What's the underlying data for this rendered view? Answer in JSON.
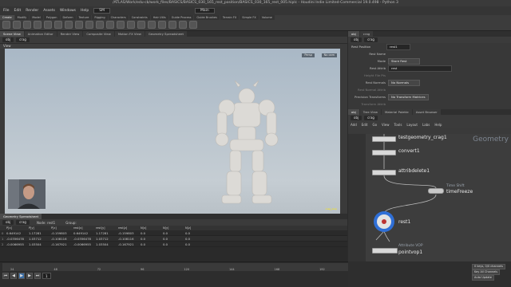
{
  "titlebar": {
    "text": "/ATLAS/Work/edu-cb/work_files/BASICS/BASICS_030_165_rest_position/BASICS_030_165_rest_005.hiplc - Houdini Indie Limited-Commercial 19.0.498 - Python 3"
  },
  "menus": [
    "File",
    "Edit",
    "Render",
    "Assets",
    "Windows",
    "Help"
  ],
  "desktop": "SM",
  "main_shelf": "Main",
  "shelf_tabs": [
    "Create",
    "Modify",
    "Model",
    "Polygon",
    "Deform",
    "Texture",
    "Rigging",
    "Characters",
    "Constraints",
    "Hair Utils",
    "Guide Process",
    "Guide Brushes",
    "Terrain FX",
    "Simple FX",
    "Volume"
  ],
  "shelf_tabs2": [
    "Lights and Cameras",
    "Collisions",
    "Particles",
    "Grains",
    "Vellum",
    "Rigid Bodies",
    "Particle Fluids",
    "Viscous Fluids",
    "Oceans",
    "Pyro FX",
    "FEM",
    "Wires",
    "Crowds",
    "Drive Simulation"
  ],
  "left_pane_tabs": [
    "Scene View",
    "Animation Editor",
    "Render View",
    "Composite View",
    "Motion FX View",
    "Geometry Spreadsheet"
  ],
  "left_path": {
    "obj": "obj",
    "node": "crag"
  },
  "viewport": {
    "label": "View",
    "persp": "Persp",
    "cam": "No cam",
    "corner_tag": "crag_loop"
  },
  "spreadsheet": {
    "tab": "Geometry Spreadsheet",
    "path_obj": "obj",
    "path_node": "crag",
    "node_label": "Node: rest1",
    "group_label": "Group:",
    "columns": [
      "",
      "P[x]",
      "P[y]",
      "P[z]",
      "rest[x]",
      "rest[y]",
      "rest[z]",
      "N[x]",
      "N[y]",
      "N[z]"
    ],
    "rows": [
      [
        "0",
        "0.649142",
        "1.17281",
        "-0.159803",
        "0.649142",
        "1.17281",
        "-0.159803",
        "0.0",
        "0.0",
        "0.0"
      ],
      [
        "1",
        "-0.0356478",
        "1.03712",
        "-0.108116",
        "-0.0356478",
        "1.03712",
        "-0.108116",
        "0.0",
        "0.0",
        "0.0"
      ],
      [
        "2",
        "-0.0066955",
        "1.03504",
        "-0.167921",
        "-0.0066955",
        "1.03504",
        "-0.167921",
        "0.0",
        "0.0",
        "0.0"
      ]
    ]
  },
  "timeline": {
    "ticks": [
      "24",
      "48",
      "72",
      "96",
      "120",
      "144",
      "168",
      "192",
      "216",
      "240"
    ],
    "current_frame": "1",
    "start": "1",
    "end": "240",
    "fps_label": "0 keys, 0/0 channels",
    "key_all": "Key All Channels",
    "auto_update": "Auto Update"
  },
  "right_top_tabs": [
    "obj",
    "crag",
    "Tree View",
    "Material Palette",
    "Asset Browser"
  ],
  "params": {
    "node_type": "Rest Position",
    "node_name": "rest1",
    "group_label": "Rest Name",
    "mode_label": "Mode",
    "mode_value": "Store Rest",
    "attrib_label": "Rest Attrib",
    "attrib_value": "rest",
    "height_label": "Height File Pts",
    "normals_label": "Rest Normals",
    "normals_value": "No Normals",
    "normal_attrib_label": "Rest Normal Attrib",
    "prec_label": "Precision Transforms",
    "prec_value": "No Transform Matrices",
    "transform_label": "Transform Attrib"
  },
  "network": {
    "tabs": [
      "obj",
      "crag"
    ],
    "menu": [
      "Add",
      "Edit",
      "Go",
      "View",
      "Tools",
      "Layout",
      "Labs",
      "Help"
    ],
    "watermark": "Geometry",
    "nodes": [
      {
        "name": "testgeometry_crag1"
      },
      {
        "name": "convert1"
      },
      {
        "name": "attribdelete1"
      },
      {
        "name": "timeFreeze",
        "sub": "Time Shift"
      },
      {
        "name": "rest1"
      },
      {
        "name": "pointvop1",
        "sub": "Attribute VOP"
      }
    ]
  },
  "colors": {
    "accent": "#3b6ea6",
    "render_flag": "#2f6fd6",
    "display_flag": "#3a8cd8"
  }
}
